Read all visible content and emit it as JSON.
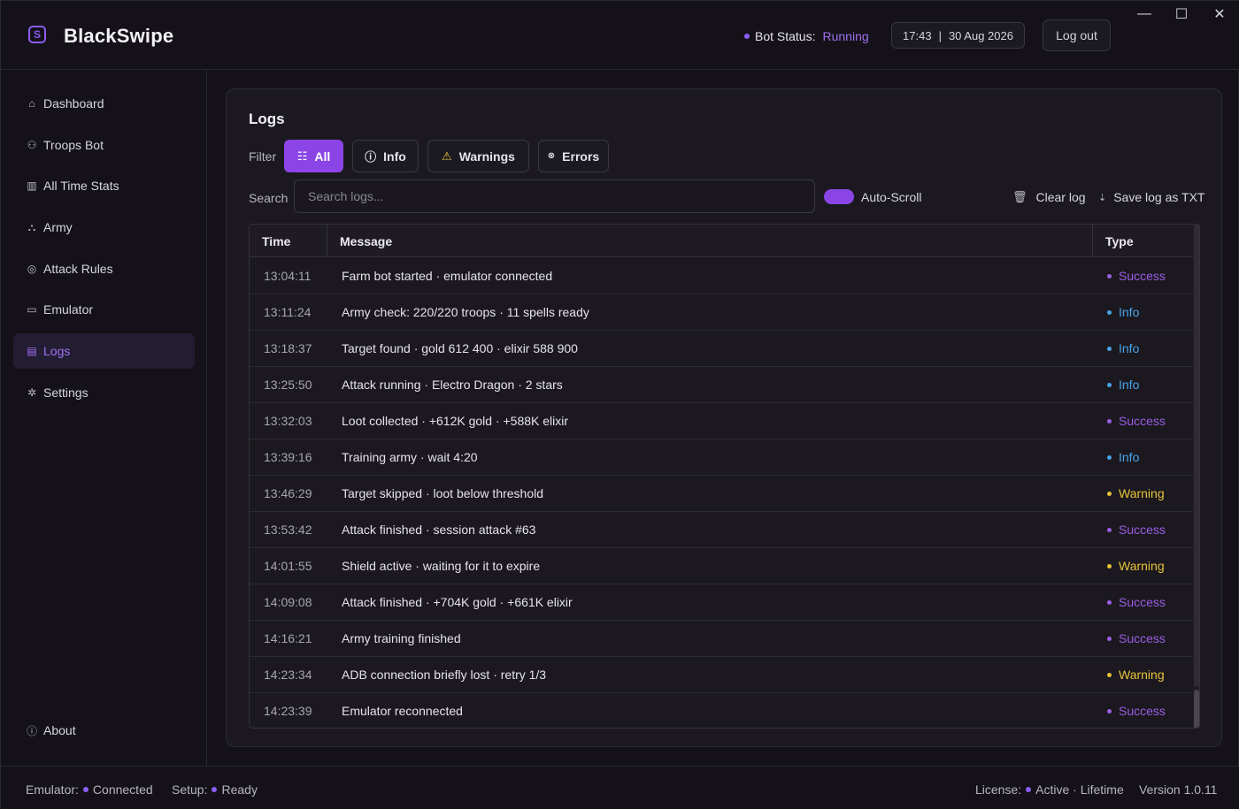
{
  "app": {
    "title": "BlackSwipe",
    "logo_letter": "S"
  },
  "header": {
    "bot_status_label": "Bot Status:",
    "bot_status_value": "Running",
    "time": "17:43",
    "separator": "|",
    "date": "30 Aug 2026",
    "logout_label": "Log out",
    "window_controls": {
      "minimize": "—",
      "maximize": "☐",
      "close": "✕"
    }
  },
  "sidebar": {
    "items": [
      {
        "label": "Dashboard",
        "icon": "home-icon",
        "glyph": "⌂",
        "active": false
      },
      {
        "label": "Troops Bot",
        "icon": "users-icon",
        "glyph": "⚇",
        "active": false
      },
      {
        "label": "All Time Stats",
        "icon": "bar-chart-icon",
        "glyph": "▥",
        "active": false
      },
      {
        "label": "Army",
        "icon": "army-icon",
        "glyph": "⛬",
        "active": false
      },
      {
        "label": "Attack Rules",
        "icon": "target-icon",
        "glyph": "◎",
        "active": false
      },
      {
        "label": "Emulator",
        "icon": "monitor-icon",
        "glyph": "▭",
        "active": false
      },
      {
        "label": "Logs",
        "icon": "document-icon",
        "glyph": "▤",
        "active": true
      },
      {
        "label": "Settings",
        "icon": "gear-icon",
        "glyph": "✲",
        "active": false
      }
    ],
    "about": {
      "label": "About",
      "icon": "info-icon",
      "glyph": "ⓘ"
    }
  },
  "logs": {
    "title": "Logs",
    "filter_label": "Filter",
    "filters": [
      {
        "label": "All",
        "icon": "grid-icon",
        "glyph": "☷",
        "active": true
      },
      {
        "label": "Info",
        "icon": "info-icon",
        "glyph": "ⓘ",
        "active": false
      },
      {
        "label": "Warnings",
        "icon": "warning-icon",
        "glyph": "⚠",
        "active": false
      },
      {
        "label": "Errors",
        "icon": "error-icon",
        "glyph": "⊗",
        "active": false
      }
    ],
    "search_label": "Search",
    "search_placeholder": "Search logs...",
    "search_value": "",
    "auto_scroll_label": "Auto-Scroll",
    "auto_scroll_on": true,
    "clear_log_label": "Clear log",
    "save_log_label": "Save log as TXT",
    "columns": [
      "Time",
      "Message",
      "Type"
    ],
    "rows": [
      {
        "time": "13:04:11",
        "message": "Farm bot started · emulator connected",
        "type": "Success"
      },
      {
        "time": "13:11:24",
        "message": "Army check: 220/220 troops · 11 spells ready",
        "type": "Info"
      },
      {
        "time": "13:18:37",
        "message": "Target found · gold 612 400 · elixir 588 900",
        "type": "Info"
      },
      {
        "time": "13:25:50",
        "message": "Attack running · Electro Dragon · 2 stars",
        "type": "Info"
      },
      {
        "time": "13:32:03",
        "message": "Loot collected · +612K gold · +588K elixir",
        "type": "Success"
      },
      {
        "time": "13:39:16",
        "message": "Training army · wait 4:20",
        "type": "Info"
      },
      {
        "time": "13:46:29",
        "message": "Target skipped · loot below threshold",
        "type": "Warning"
      },
      {
        "time": "13:53:42",
        "message": "Attack finished · session attack #63",
        "type": "Success"
      },
      {
        "time": "14:01:55",
        "message": "Shield active · waiting for it to expire",
        "type": "Warning"
      },
      {
        "time": "14:09:08",
        "message": "Attack finished · +704K gold · +661K elixir",
        "type": "Success"
      },
      {
        "time": "14:16:21",
        "message": "Army training finished",
        "type": "Success"
      },
      {
        "time": "14:23:34",
        "message": "ADB connection briefly lost · retry 1/3",
        "type": "Warning"
      },
      {
        "time": "14:23:39",
        "message": "Emulator reconnected",
        "type": "Success"
      }
    ]
  },
  "footer": {
    "emulator_label": "Emulator:",
    "emulator_value": "Connected",
    "setup_label": "Setup:",
    "setup_value": "Ready",
    "license_label": "License:",
    "license_value": "Active · Lifetime",
    "version": "Version 1.0.11"
  },
  "colors": {
    "accent": "#8b45e6",
    "success": "#9b5de5",
    "info": "#4aa3e8",
    "warning": "#e8c23a"
  }
}
